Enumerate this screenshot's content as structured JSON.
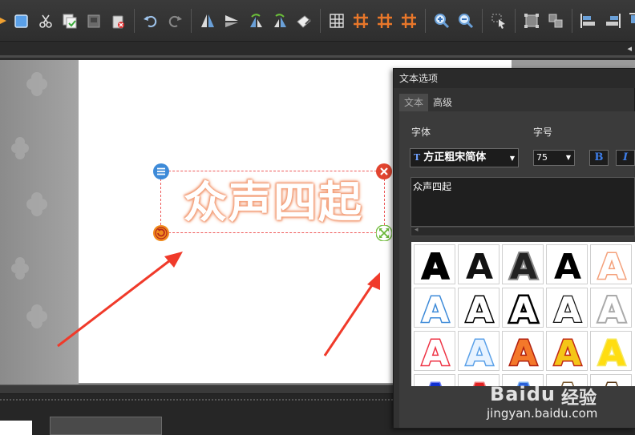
{
  "toolbar": {
    "icons": [
      "prev-icon",
      "page-icon",
      "cut-icon",
      "copy-icon",
      "film-icon",
      "delete-icon",
      "undo-icon",
      "redo-icon",
      "flip-h-icon",
      "flip-v-icon",
      "rotate-left-icon",
      "rotate-right-icon",
      "clean-icon",
      "grid-icon",
      "grid-orange-icon",
      "grid-orange-2-icon",
      "grid-orange-3-icon",
      "zoom-in-icon",
      "zoom-out-icon",
      "select-icon",
      "group-icon",
      "ungroup-icon",
      "align-left-icon",
      "align-right-icon",
      "align-top-icon"
    ],
    "more_arrow": "◂"
  },
  "canvas": {
    "art_text": "众声四起"
  },
  "panel": {
    "title": "文本选项",
    "tabs": [
      {
        "label": "文本",
        "active": true
      },
      {
        "label": "高级",
        "active": false
      }
    ],
    "font_label": "字体",
    "size_label": "字号",
    "font_value": "方正粗宋简体",
    "font_icon": "T",
    "size_value": "75",
    "bold_label": "B",
    "italic_label": "I",
    "text_value": "众声四起",
    "preset_glyph": "A"
  },
  "watermark": {
    "logo": "Bai",
    "logo_tail": "du",
    "brand_cn": "经验",
    "url": "jingyan.baidu.com"
  },
  "colors": {
    "accent_red": "#ee4433",
    "accent_blue": "#3d7de8",
    "panel_bg": "#323232",
    "glow_orange": "#f4a07a"
  }
}
